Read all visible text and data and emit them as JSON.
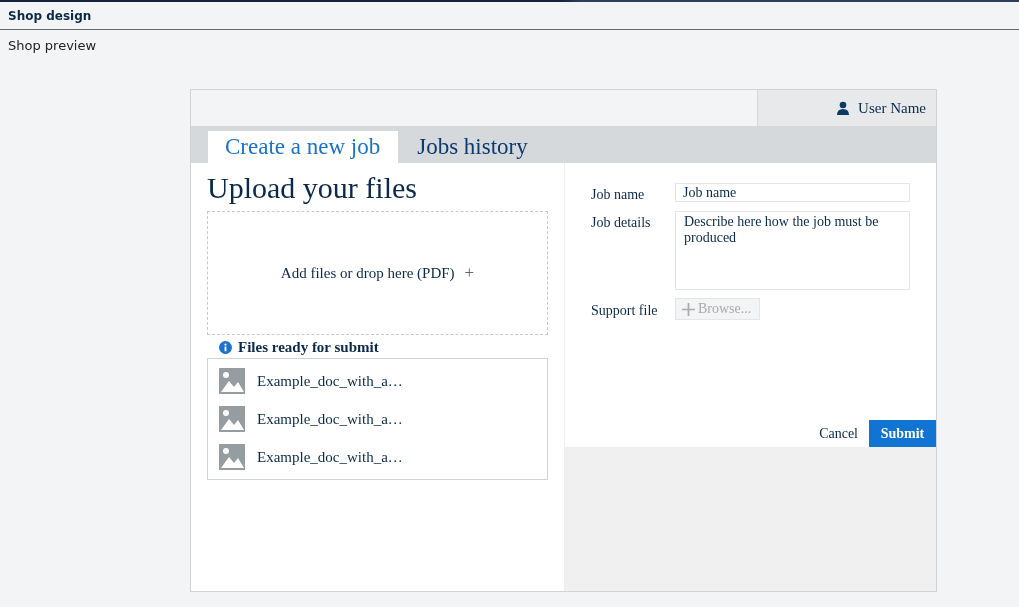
{
  "app": {
    "title": "Shop design",
    "subtitle": "Shop preview"
  },
  "user": {
    "name": "User Name"
  },
  "tabs": [
    {
      "label": "Create a new job",
      "selected": true
    },
    {
      "label": "Jobs history",
      "selected": false
    }
  ],
  "heading": "Upload your files",
  "dropzone": {
    "label": "Add files or drop here (PDF)",
    "icon": "+"
  },
  "files_title": "Files ready for submit",
  "files": [
    {
      "name": "Example_doc_with_a…"
    },
    {
      "name": "Example_doc_with_a…"
    },
    {
      "name": "Example_doc_with_a…"
    }
  ],
  "form": {
    "job_name": {
      "label": "Job name",
      "value": "Job name"
    },
    "job_details": {
      "label": "Job details",
      "value": "Describe here how the job must be produced"
    },
    "support_file": {
      "label": "Support file",
      "button": "Browse...",
      "disabled": true
    }
  },
  "buttons": {
    "cancel": "Cancel",
    "submit": "Submit"
  }
}
